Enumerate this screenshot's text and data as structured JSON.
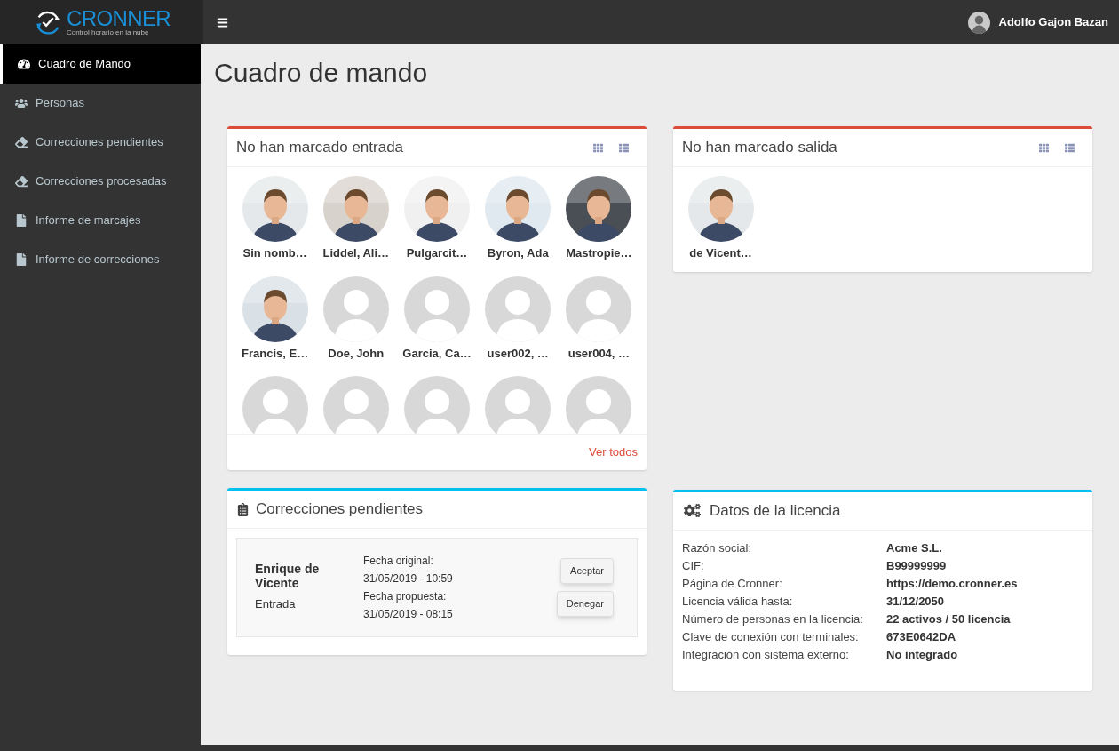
{
  "logo": {
    "name": "CRONNER",
    "tagline": "Control horario en la nube"
  },
  "user": {
    "name": "Adolfo Gajon Bazan"
  },
  "sidebar": {
    "items": [
      {
        "label": "Cuadro de Mando",
        "selected": true
      },
      {
        "label": "Personas",
        "selected": false
      },
      {
        "label": "Correcciones pendientes",
        "selected": false
      },
      {
        "label": "Correcciones procesadas",
        "selected": false
      },
      {
        "label": "Informe de marcajes",
        "selected": false
      },
      {
        "label": "Informe de correcciones",
        "selected": false
      }
    ]
  },
  "page_title": "Cuadro de mando",
  "no_entry": {
    "title": "No han marcado entrada",
    "link": "Ver todos",
    "people": [
      {
        "name": "Sin nomb…"
      },
      {
        "name": "Liddel, Ali…"
      },
      {
        "name": "Pulgarcit…"
      },
      {
        "name": "Byron, Ada"
      },
      {
        "name": "Mastropie…"
      },
      {
        "name": "Francis, E…"
      },
      {
        "name": "Doe, John",
        "kind": "placeholder"
      },
      {
        "name": "Garcia, Ca…",
        "kind": "placeholder"
      },
      {
        "name": "user002, …",
        "kind": "placeholder"
      },
      {
        "name": "user004, …",
        "kind": "placeholder"
      },
      {
        "kind": "placeholder"
      },
      {
        "kind": "placeholder"
      },
      {
        "kind": "placeholder"
      },
      {
        "kind": "placeholder"
      },
      {
        "kind": "placeholder"
      }
    ]
  },
  "no_exit": {
    "title": "No han marcado salida",
    "people": [
      {
        "name": "de Vicent…"
      }
    ]
  },
  "corrections": {
    "title": "Correcciones pendientes",
    "items": [
      {
        "person": "Enrique de Vicente",
        "type": "Entrada",
        "original_label": "Fecha original:",
        "original": "31/05/2019 - 10:59",
        "proposed_label": "Fecha propuesta:",
        "proposed": "31/05/2019 - 08:15",
        "accept": "Aceptar",
        "deny": "Denegar"
      }
    ]
  },
  "license": {
    "title": "Datos de la licencia",
    "rows": [
      {
        "label": "Razón social:",
        "value": "Acme S.L."
      },
      {
        "label": "CIF:",
        "value": "B99999999"
      },
      {
        "label": "Página de Cronner:",
        "value": "https://demo.cronner.es"
      },
      {
        "label": "Licencia válida hasta:",
        "value": "31/12/2050"
      },
      {
        "label": "Número de personas en la licencia:",
        "value": "22 activos / 50 licencia"
      },
      {
        "label": "Clave de conexión con terminales:",
        "value": "673E0642DA"
      },
      {
        "label": "Integración con sistema externo:",
        "value": "No integrado"
      }
    ]
  }
}
